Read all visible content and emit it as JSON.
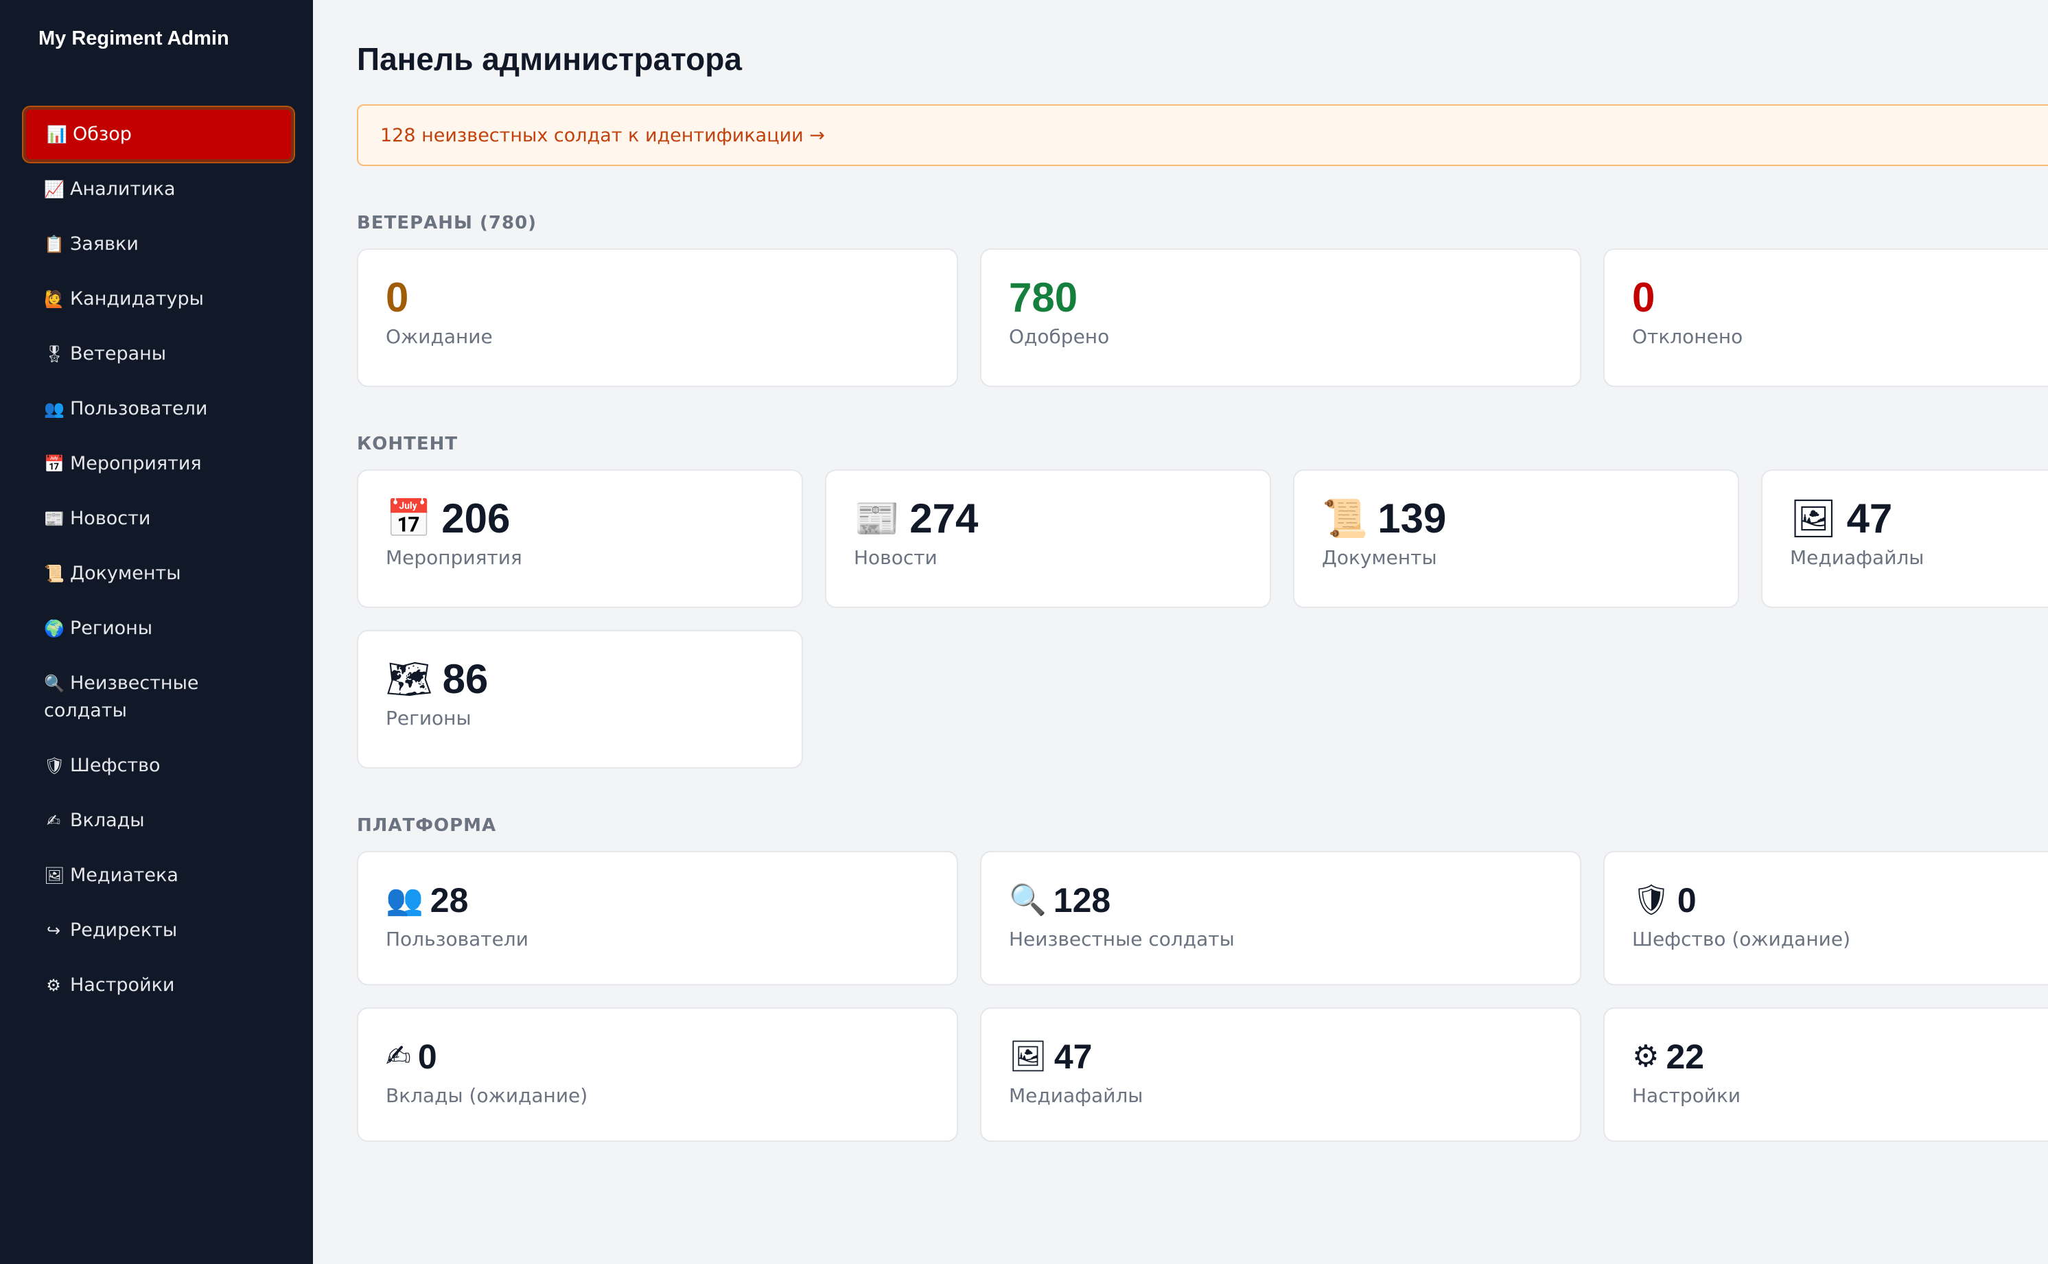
{
  "app": {
    "brand": "My Regiment Admin"
  },
  "sidebar": {
    "items": [
      {
        "icon": "📊",
        "label": "Обзор"
      },
      {
        "icon": "📈",
        "label": "Аналитика"
      },
      {
        "icon": "📋",
        "label": "Заявки"
      },
      {
        "icon": "🙋",
        "label": "Кандидатуры"
      },
      {
        "icon": "🎖",
        "label": "Ветераны"
      },
      {
        "icon": "👥",
        "label": "Пользователи"
      },
      {
        "icon": "📅",
        "label": "Мероприятия"
      },
      {
        "icon": "📰",
        "label": "Новости"
      },
      {
        "icon": "📜",
        "label": "Документы"
      },
      {
        "icon": "🌍",
        "label": "Регионы"
      },
      {
        "icon": "🔍",
        "label": "Неизвестные солдаты"
      },
      {
        "icon": "🛡",
        "label": "Шефство"
      },
      {
        "icon": "✍",
        "label": "Вклады"
      },
      {
        "icon": "🖼",
        "label": "Медиатека"
      },
      {
        "icon": "↪",
        "label": "Редиректы"
      },
      {
        "icon": "⚙",
        "label": "Настройки"
      }
    ]
  },
  "main": {
    "title": "Панель администратора",
    "banner": "128 неизвестных солдат к идентификации →",
    "veterans": {
      "title": "ВЕТЕРАНЫ (780)",
      "cards": [
        {
          "value": "0",
          "label": "Ожидание"
        },
        {
          "value": "780",
          "label": "Одобрено"
        },
        {
          "value": "0",
          "label": "Отклонено"
        }
      ]
    },
    "content": {
      "title": "КОНТЕНТ",
      "cards": [
        {
          "icon": "📅",
          "value": "206",
          "label": "Мероприятия"
        },
        {
          "icon": "📰",
          "value": "274",
          "label": "Новости"
        },
        {
          "icon": "📜",
          "value": "139",
          "label": "Документы"
        },
        {
          "icon": "🖼",
          "value": "47",
          "label": "Медиафайлы"
        },
        {
          "icon": "🗺",
          "value": "86",
          "label": "Регионы"
        }
      ]
    },
    "platform": {
      "title": "ПЛАТФОРМА",
      "cards": [
        {
          "icon": "👥",
          "value": "28",
          "label": "Пользователи"
        },
        {
          "icon": "🔍",
          "value": "128",
          "label": "Неизвестные солдаты"
        },
        {
          "icon": "🛡",
          "value": "0",
          "label": "Шефство (ожидание)"
        },
        {
          "icon": "✍",
          "value": "0",
          "label": "Вклады (ожидание)"
        },
        {
          "icon": "🖼",
          "value": "47",
          "label": "Медиафайлы"
        },
        {
          "icon": "⚙",
          "value": "22",
          "label": "Настройки"
        }
      ]
    }
  },
  "colors": {
    "sidebar_bg": "#111827",
    "active_item_bg": "#c30000",
    "pending": "#a15c07",
    "approved": "#15803d",
    "rejected": "#c30000",
    "banner_text": "#c2410c"
  }
}
